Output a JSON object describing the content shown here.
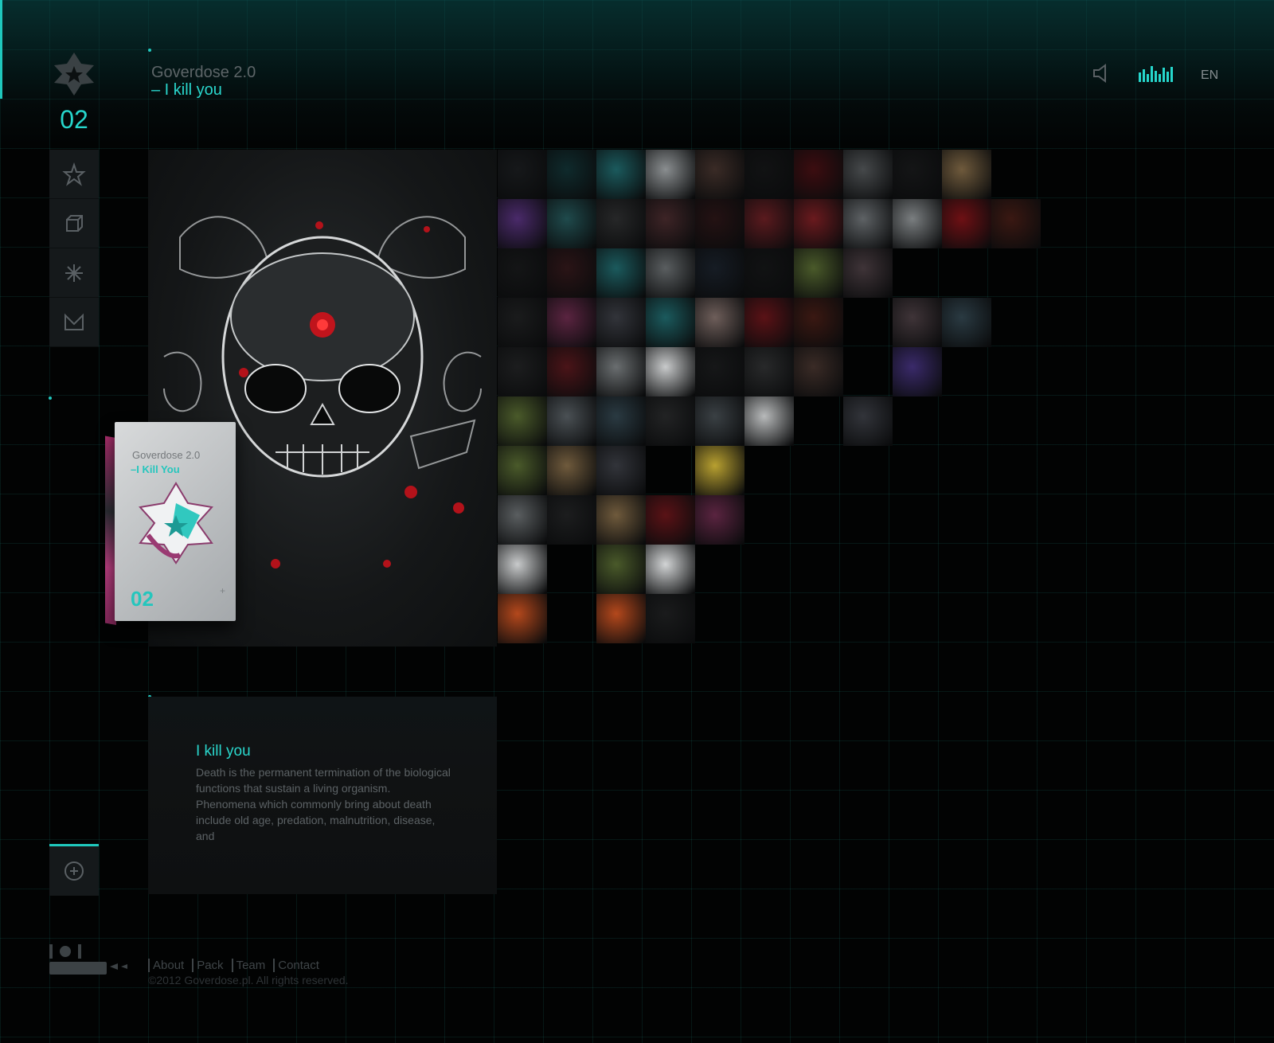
{
  "header": {
    "title": "Goverdose 2.0",
    "subtitle": "– I kill you",
    "page_number": "02",
    "language": "EN"
  },
  "colors": {
    "accent": "#26d6cc",
    "panel": "#15191b",
    "background": "#020303"
  },
  "side_nav": [
    {
      "icon": "star-icon"
    },
    {
      "icon": "cube-icon"
    },
    {
      "icon": "burst-icon"
    },
    {
      "icon": "mail-icon"
    }
  ],
  "album": {
    "title": "Goverdose 2.0",
    "subtitle": "–I Kill You",
    "number": "02"
  },
  "mosaic": {
    "tiles": [
      {
        "row": 0,
        "col": 0,
        "c": "#16181a"
      },
      {
        "row": 0,
        "col": 1,
        "c": "#0f2a2c"
      },
      {
        "row": 0,
        "col": 2,
        "c": "#1b5a5d"
      },
      {
        "row": 0,
        "col": 3,
        "c": "#8a8e90"
      },
      {
        "row": 0,
        "col": 4,
        "c": "#3a2b26"
      },
      {
        "row": 0,
        "col": 5,
        "c": "#111213"
      },
      {
        "row": 0,
        "col": 6,
        "c": "#3c0d10"
      },
      {
        "row": 0,
        "col": 7,
        "c": "#46494b"
      },
      {
        "row": 0,
        "col": 8,
        "c": "#141516"
      },
      {
        "row": 0,
        "col": 9,
        "c": "#6f5a3c"
      },
      {
        "row": 1,
        "col": 0,
        "c": "#4a2a6a"
      },
      {
        "row": 1,
        "col": 1,
        "c": "#1f4a4c"
      },
      {
        "row": 1,
        "col": 2,
        "c": "#262728"
      },
      {
        "row": 1,
        "col": 3,
        "c": "#3d2426"
      },
      {
        "row": 1,
        "col": 4,
        "c": "#241213"
      },
      {
        "row": 1,
        "col": 5,
        "c": "#5a1a1e"
      },
      {
        "row": 1,
        "col": 6,
        "c": "#6a1a1e"
      },
      {
        "row": 1,
        "col": 7,
        "c": "#5e6265"
      },
      {
        "row": 1,
        "col": 8,
        "c": "#7a7e80"
      },
      {
        "row": 1,
        "col": 9,
        "c": "#6e1014"
      },
      {
        "row": 1,
        "col": 10,
        "c": "#3a1812"
      },
      {
        "row": 2,
        "col": 0,
        "c": "#141516"
      },
      {
        "row": 2,
        "col": 1,
        "c": "#2a1416"
      },
      {
        "row": 2,
        "col": 2,
        "c": "#1b5a5d"
      },
      {
        "row": 2,
        "col": 3,
        "c": "#5a5e60"
      },
      {
        "row": 2,
        "col": 4,
        "c": "#161c24"
      },
      {
        "row": 2,
        "col": 5,
        "c": "#111213"
      },
      {
        "row": 2,
        "col": 6,
        "c": "#4a5a2a"
      },
      {
        "row": 2,
        "col": 7,
        "c": "#3f3438"
      },
      {
        "row": 3,
        "col": 0,
        "c": "#1a1b1c"
      },
      {
        "row": 3,
        "col": 1,
        "c": "#5a2440"
      },
      {
        "row": 3,
        "col": 2,
        "c": "#32343a"
      },
      {
        "row": 3,
        "col": 3,
        "c": "#1b5a5d"
      },
      {
        "row": 3,
        "col": 4,
        "c": "#6e5e5a"
      },
      {
        "row": 3,
        "col": 5,
        "c": "#5a1216"
      },
      {
        "row": 3,
        "col": 6,
        "c": "#3a1812"
      },
      {
        "row": 3,
        "col": 8,
        "c": "#3f3438"
      },
      {
        "row": 3,
        "col": 9,
        "c": "#2a3a42"
      },
      {
        "row": 4,
        "col": 0,
        "c": "#1c1d1e"
      },
      {
        "row": 4,
        "col": 1,
        "c": "#4a1418"
      },
      {
        "row": 4,
        "col": 2,
        "c": "#6a6e70"
      },
      {
        "row": 4,
        "col": 3,
        "c": "#c8cacb"
      },
      {
        "row": 4,
        "col": 4,
        "c": "#161718"
      },
      {
        "row": 4,
        "col": 5,
        "c": "#28292a"
      },
      {
        "row": 4,
        "col": 6,
        "c": "#3a2b26"
      },
      {
        "row": 4,
        "col": 8,
        "c": "#3a2a6a"
      },
      {
        "row": 5,
        "col": 0,
        "c": "#4a5a2a"
      },
      {
        "row": 5,
        "col": 1,
        "c": "#4a5054"
      },
      {
        "row": 5,
        "col": 2,
        "c": "#2a3a42"
      },
      {
        "row": 5,
        "col": 3,
        "c": "#222324"
      },
      {
        "row": 5,
        "col": 4,
        "c": "#3a4044"
      },
      {
        "row": 5,
        "col": 5,
        "c": "#b8babb"
      },
      {
        "row": 5,
        "col": 7,
        "c": "#32343a"
      },
      {
        "row": 6,
        "col": 0,
        "c": "#4a5a2a"
      },
      {
        "row": 6,
        "col": 1,
        "c": "#6f5a3c"
      },
      {
        "row": 6,
        "col": 2,
        "c": "#32343a"
      },
      {
        "row": 6,
        "col": 4,
        "c": "#b8a030"
      },
      {
        "row": 7,
        "col": 0,
        "c": "#5a5e60"
      },
      {
        "row": 7,
        "col": 1,
        "c": "#1c1d1e"
      },
      {
        "row": 7,
        "col": 2,
        "c": "#6f5a3c"
      },
      {
        "row": 7,
        "col": 3,
        "c": "#5a1216"
      },
      {
        "row": 7,
        "col": 4,
        "c": "#5a2440"
      },
      {
        "row": 8,
        "col": 0,
        "c": "#c8cacb"
      },
      {
        "row": 8,
        "col": 2,
        "c": "#4a5a2a"
      },
      {
        "row": 8,
        "col": 3,
        "c": "#d2d4d5"
      },
      {
        "row": 9,
        "col": 0,
        "c": "#b4481c"
      },
      {
        "row": 9,
        "col": 2,
        "c": "#b4481c"
      },
      {
        "row": 9,
        "col": 3,
        "c": "#1a1b1c"
      }
    ]
  },
  "description": {
    "title": "I kill you",
    "body": "Death is the permanent termination of the biological functions that sustain a living organism. Phenomena which commonly bring about death include old age, predation, malnutrition, disease, and"
  },
  "footer": {
    "links": [
      "About",
      "Pack",
      "Team",
      "Contact"
    ],
    "copyright": "©2012 Goverdose.pl. All rights reserved."
  }
}
